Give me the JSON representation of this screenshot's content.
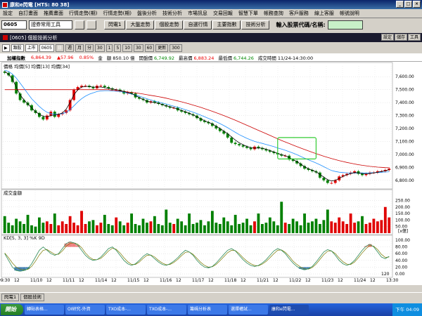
{
  "window": {
    "title": "康和e閃電 [HTS: 80 38]",
    "btn_min": "_",
    "btn_max": "□",
    "btn_close": "×"
  },
  "menu": [
    "設定",
    "自訂畫面",
    "推薦畫面",
    "行情走勢(期)",
    "行情走勢(期)",
    "盤後分析",
    "技術分析",
    "市場訊息",
    "交易回報",
    "智慧下單",
    "帳務查詢",
    "客戶服務",
    "線上客服",
    "帳號說明"
  ],
  "toolbar": {
    "code": "0605",
    "selector": "證券常用工具",
    "buttons": [
      "閃電1",
      "大盤走勢",
      "個股走勢",
      "自選行情",
      "主要指數",
      "技術分析"
    ],
    "search_label": "輸入股票代碼/名稱:",
    "search_value": ""
  },
  "chart_window": {
    "title": "[0605] 個股技術分析",
    "buttons": [
      "設定",
      "儲存",
      "工具"
    ]
  },
  "controls": {
    "items": [
      "▶",
      "類股",
      "上市",
      "0605",
      "日",
      "週",
      "月",
      "分",
      "30",
      "1",
      "5",
      "10",
      "30",
      "60",
      "更新",
      "300"
    ],
    "selected_index": 4
  },
  "quote": {
    "name": "加權指數",
    "items": [
      {
        "label": "",
        "value": "6,864.39",
        "color": "red"
      },
      {
        "label": "",
        "value": "▲57.96",
        "color": "red"
      },
      {
        "label": "",
        "value": "0.85%",
        "color": "red"
      },
      {
        "label": "金",
        "value": "",
        "color": "black"
      },
      {
        "label": "額",
        "value": "850.10 億",
        "color": "black"
      },
      {
        "label": "開盤價",
        "value": "6,749.92",
        "color": "green"
      },
      {
        "label": "最高價",
        "value": "6,883.24",
        "color": "red"
      },
      {
        "label": "最低價",
        "value": "6,744.26",
        "color": "green"
      },
      {
        "label": "成交時間",
        "value": "11/24-14:30:00",
        "color": "black"
      }
    ]
  },
  "chart_data": {
    "type": "candlestick",
    "price_panel_label": "價格 均價[5] 均價[13] 均價[34]",
    "price_ticks": [
      "7,600.00",
      "7,500.00",
      "7,400.00",
      "7,300.00",
      "7,200.00",
      "7,100.00",
      "7,000.00",
      "6,900.00",
      "6,800.00"
    ],
    "price_ylim": [
      6750,
      7650
    ],
    "volume_panel_label": "成交金額",
    "volume_ticks": [
      "250.00",
      "200.00",
      "150.00",
      "100.00",
      "50.00"
    ],
    "volume_unit": "[x億]",
    "volume_ylim": [
      0,
      290
    ],
    "kd_panel_label": "KD[5, 3, 3] %K 9D",
    "kd_ticks": [
      "100.00",
      "80.00",
      "60.00",
      "40.00",
      "20.00",
      "0.00"
    ],
    "x_labels": [
      "09:30",
      "12",
      "11/10",
      "12",
      "11/11",
      "12",
      "11/14",
      "12",
      "11/15",
      "12",
      "11/16",
      "12",
      "11/17",
      "12",
      "11/18",
      "12",
      "11/21",
      "12",
      "11/22",
      "12",
      "11/23",
      "12",
      "11/24",
      "12",
      "13:30"
    ],
    "x_range_label": "120",
    "candles_open": [
      7640,
      7630,
      7610,
      7560,
      7470,
      7420,
      7400,
      7380,
      7340,
      7320,
      7290,
      7270,
      7300,
      7330,
      7290,
      7310,
      7320,
      7340,
      7420,
      7500,
      7520,
      7530,
      7530,
      7520,
      7510,
      7530,
      7530,
      7520,
      7510,
      7500,
      7500,
      7490,
      7470,
      7480,
      7470,
      7440,
      7430,
      7420,
      7400,
      7410,
      7400,
      7390,
      7380,
      7370,
      7360,
      7360,
      7340,
      7330,
      7320,
      7310,
      7300,
      7280,
      7260,
      7250,
      7240,
      7220,
      7200,
      7180,
      7160,
      7130,
      7090,
      7080,
      7070,
      7060,
      7050,
      7040,
      7060,
      7050,
      7040,
      7030,
      7020,
      7010,
      7000,
      6990,
      6990,
      6960,
      6950,
      6930,
      6910,
      6890,
      6880,
      6870,
      6860,
      6820,
      6800,
      6780,
      6780,
      6800,
      6830,
      6840,
      6850,
      6860,
      6870,
      6850,
      6840,
      6850,
      6860,
      6860,
      6870,
      6870,
      6880
    ],
    "candles_close": [
      7630,
      7610,
      7560,
      7470,
      7420,
      7400,
      7380,
      7340,
      7320,
      7290,
      7270,
      7300,
      7330,
      7290,
      7310,
      7320,
      7340,
      7420,
      7500,
      7520,
      7530,
      7530,
      7520,
      7510,
      7530,
      7530,
      7520,
      7510,
      7500,
      7500,
      7490,
      7470,
      7480,
      7470,
      7440,
      7430,
      7420,
      7400,
      7410,
      7400,
      7390,
      7380,
      7370,
      7360,
      7360,
      7340,
      7330,
      7320,
      7310,
      7300,
      7280,
      7260,
      7250,
      7240,
      7220,
      7200,
      7180,
      7160,
      7130,
      7090,
      7080,
      7070,
      7060,
      7050,
      7040,
      7060,
      7050,
      7040,
      7030,
      7020,
      7010,
      7000,
      6990,
      6990,
      6960,
      6950,
      6930,
      6910,
      6890,
      6880,
      6870,
      6860,
      6820,
      6800,
      6780,
      6780,
      6800,
      6830,
      6840,
      6850,
      6860,
      6870,
      6850,
      6840,
      6850,
      6860,
      6860,
      6870,
      6870,
      6880,
      6890
    ],
    "volume": [
      130,
      80,
      60,
      110,
      90,
      70,
      140,
      60,
      50,
      120,
      80,
      90,
      70,
      150,
      60,
      90,
      70,
      130,
      80,
      60,
      170,
      70,
      90,
      100,
      60,
      80,
      140,
      70,
      60,
      120,
      90,
      60,
      80,
      150,
      70,
      60,
      110,
      80,
      90,
      130,
      70,
      60,
      180,
      80,
      70,
      110,
      90,
      60,
      150,
      70,
      80,
      100,
      60,
      90,
      170,
      80,
      70,
      120,
      90,
      60,
      140,
      70,
      80,
      110,
      60,
      90,
      150,
      70,
      80,
      120,
      90,
      60,
      240,
      80,
      70,
      110,
      90,
      60,
      150,
      80,
      90,
      110,
      70,
      100,
      180,
      90,
      80,
      120,
      90,
      70,
      150,
      80,
      90,
      130,
      70,
      80,
      110,
      90,
      100,
      200,
      120
    ],
    "ma_fast": [
      7640,
      7620,
      7580,
      7520,
      7460,
      7420,
      7390,
      7360,
      7330,
      7310,
      7295,
      7290,
      7300,
      7305,
      7310,
      7320,
      7350,
      7400,
      7460,
      7500,
      7520,
      7525,
      7525,
      7520,
      7520,
      7520,
      7515,
      7510,
      7505,
      7500,
      7495,
      7485,
      7478,
      7470,
      7455,
      7440,
      7425,
      7410,
      7405,
      7400,
      7395,
      7385,
      7375,
      7368,
      7360,
      7350,
      7340,
      7330,
      7318,
      7305,
      7290,
      7275,
      7260,
      7248,
      7235,
      7218,
      7200,
      7180,
      7160,
      7135,
      7110,
      7090,
      7075,
      7062,
      7052,
      7048,
      7050,
      7048,
      7040,
      7030,
      7020,
      7008,
      6998,
      6990,
      6975,
      6960,
      6945,
      6925,
      6905,
      6890,
      6878,
      6866,
      6845,
      6825,
      6805,
      6795,
      6800,
      6815,
      6830,
      6842,
      6852,
      6860,
      6858,
      6852,
      6850,
      6852,
      6858,
      6862,
      6868,
      6874,
      6882
    ],
    "ma_slow": [
      7650,
      7640,
      7620,
      7590,
      7550,
      7510,
      7470,
      7430,
      7400,
      7370,
      7345,
      7325,
      7315,
      7310,
      7310,
      7315,
      7325,
      7345,
      7375,
      7405,
      7430,
      7450,
      7465,
      7475,
      7485,
      7490,
      7492,
      7492,
      7490,
      7488,
      7485,
      7480,
      7473,
      7466,
      7458,
      7450,
      7440,
      7430,
      7420,
      7412,
      7405,
      7397,
      7389,
      7380,
      7372,
      7364,
      7355,
      7345,
      7336,
      7326,
      7315,
      7303,
      7291,
      7278,
      7266,
      7252,
      7238,
      7222,
      7206,
      7188,
      7170,
      7153,
      7138,
      7124,
      7112,
      7100,
      7092,
      7085,
      7077,
      7069,
      7060,
      7050,
      7041,
      7032,
      7021,
      7010,
      6998,
      6985,
      6971,
      6958,
      6946,
      6934,
      6920,
      6905,
      6890,
      6876,
      6868,
      6863,
      6860,
      6858,
      6857,
      6857,
      6857,
      6857,
      6857,
      6858,
      6859,
      6860,
      6862,
      6864,
      6866
    ],
    "ma_long": [
      7500,
      7500,
      7500,
      7500,
      7500,
      7500,
      7500,
      7500,
      7500,
      7500,
      7500,
      7500,
      7500,
      7500,
      7500,
      7500,
      7500,
      7500,
      7500,
      7500,
      7500,
      7500,
      7500,
      7500,
      7500,
      7500,
      7500,
      7500,
      7495,
      7492,
      7489,
      7486,
      7482,
      7479,
      7475,
      7471,
      7466,
      7461,
      7456,
      7451,
      7446,
      7440,
      7434,
      7427,
      7420,
      7413,
      7406,
      7398,
      7390,
      7381,
      7372,
      7363,
      7353,
      7343,
      7333,
      7322,
      7311,
      7300,
      7288,
      7276,
      7264,
      7251,
      7238,
      7225,
      7212,
      7199,
      7186,
      7173,
      7160,
      7147,
      7134,
      7121,
      7108,
      7096,
      7084,
      7072,
      7060,
      7049,
      7038,
      7027,
      7016,
      7006,
      6996,
      6986,
      6977,
      6968,
      6960,
      6952,
      6945,
      6938,
      6932,
      6926,
      6921,
      6916,
      6912,
      6908,
      6905,
      6902,
      6900,
      6898,
      6897
    ],
    "kd_k": [
      60,
      40,
      20,
      10,
      8,
      10,
      15,
      30,
      50,
      70,
      80,
      70,
      60,
      55,
      60,
      75,
      90,
      95,
      92,
      85,
      70,
      55,
      45,
      40,
      42,
      50,
      62,
      75,
      80,
      70,
      55,
      40,
      30,
      25,
      30,
      40,
      52,
      60,
      55,
      45,
      35,
      28,
      25,
      30,
      38,
      48,
      60,
      70,
      65,
      55,
      40,
      28,
      20,
      18,
      22,
      32,
      45,
      58,
      70,
      75,
      68,
      55,
      42,
      32,
      25,
      22,
      25,
      32,
      42,
      55,
      68,
      75,
      70,
      60,
      45,
      32,
      22,
      15,
      12,
      15,
      22,
      35,
      50,
      65,
      72,
      68,
      55,
      40,
      30,
      25,
      30,
      40,
      55,
      70,
      82,
      88,
      80,
      65,
      50,
      45,
      52
    ],
    "kd_d": [
      62,
      48,
      32,
      20,
      14,
      12,
      13,
      22,
      38,
      56,
      70,
      72,
      65,
      58,
      58,
      68,
      82,
      90,
      92,
      88,
      78,
      62,
      50,
      43,
      42,
      46,
      56,
      68,
      76,
      73,
      62,
      48,
      36,
      28,
      28,
      35,
      46,
      55,
      56,
      50,
      40,
      32,
      27,
      28,
      34,
      43,
      54,
      64,
      65,
      58,
      46,
      34,
      25,
      20,
      21,
      28,
      39,
      51,
      63,
      70,
      69,
      60,
      48,
      38,
      30,
      25,
      24,
      29,
      37,
      48,
      60,
      70,
      71,
      64,
      52,
      38,
      28,
      20,
      15,
      14,
      19,
      29,
      43,
      57,
      67,
      68,
      60,
      47,
      36,
      29,
      28,
      35,
      48,
      62,
      75,
      84,
      82,
      72,
      58,
      49,
      50
    ]
  },
  "status_tabs": [
    "閃電1",
    "個股技術"
  ],
  "taskbar": {
    "start": "開始",
    "tasks": [
      "轉貼表格...",
      "OI研究-外資",
      "TXO成本-...",
      "TXO成本-...",
      "籌碼分析表",
      "選擇權試...",
      "康和e閃電..."
    ],
    "active_index": 6,
    "clock": "下午 04:09"
  },
  "colors": {
    "up": "#e00000",
    "down": "#008000",
    "ma_fast": "#000000",
    "ma_slow": "#1e90ff",
    "ma_long": "#cc0000",
    "kd_k": "#2e8b57",
    "kd_d": "#7a7a00",
    "highlight": "#33cc33"
  }
}
